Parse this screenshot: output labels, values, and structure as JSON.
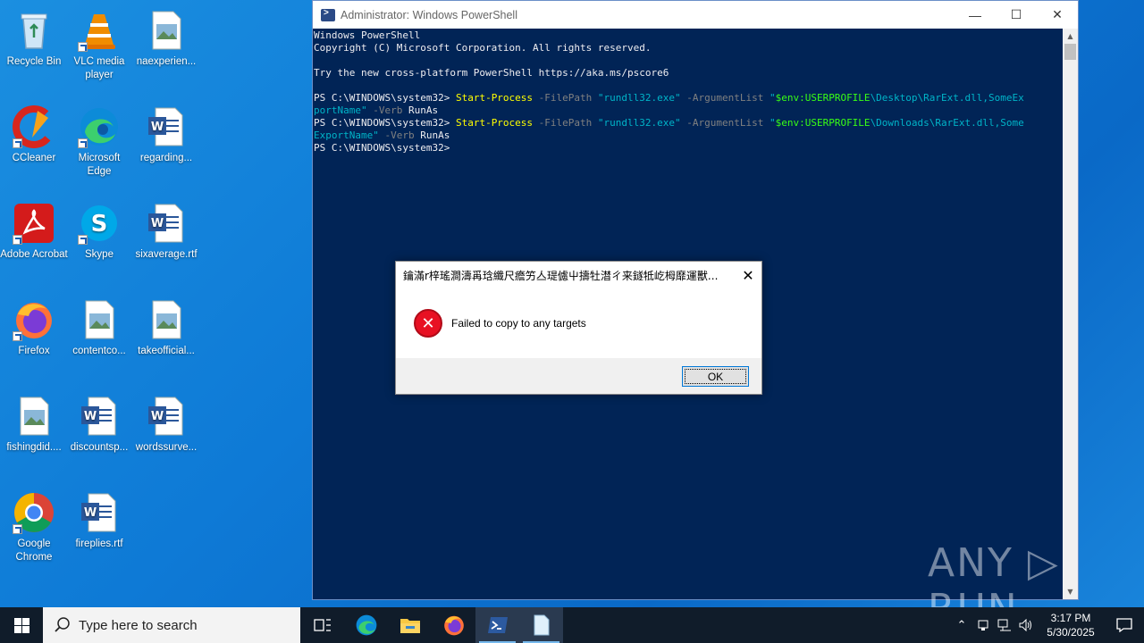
{
  "desktop": {
    "icons": [
      {
        "label": "Recycle Bin",
        "icon": "recycle-bin-icon"
      },
      {
        "label": "VLC media player",
        "icon": "vlc-icon"
      },
      {
        "label": "naexperien...",
        "icon": "image-file-icon"
      },
      {
        "label": "CCleaner",
        "icon": "ccleaner-icon"
      },
      {
        "label": "Microsoft Edge",
        "icon": "edge-icon"
      },
      {
        "label": "regarding...",
        "icon": "word-doc-icon"
      },
      {
        "label": "Adobe Acrobat",
        "icon": "acrobat-icon"
      },
      {
        "label": "Skype",
        "icon": "skype-icon"
      },
      {
        "label": "sixaverage.rtf",
        "icon": "word-doc-icon"
      },
      {
        "label": "Firefox",
        "icon": "firefox-icon"
      },
      {
        "label": "contentco...",
        "icon": "image-file-icon"
      },
      {
        "label": "takeofficial...",
        "icon": "image-file-icon"
      },
      {
        "label": "fishingdid....",
        "icon": "image-file-icon"
      },
      {
        "label": "discountsp...",
        "icon": "word-doc-icon"
      },
      {
        "label": "wordssurve...",
        "icon": "word-doc-icon"
      },
      {
        "label": "Google Chrome",
        "icon": "chrome-icon"
      },
      {
        "label": "fireplies.rtf",
        "icon": "word-doc-icon"
      }
    ]
  },
  "powershell": {
    "title": "Administrator: Windows PowerShell",
    "lines": {
      "l1": "Windows PowerShell",
      "l2": "Copyright (C) Microsoft Corporation. All rights reserved.",
      "l3": "Try the new cross-platform PowerShell https://aka.ms/pscore6",
      "prompt": "PS C:\\WINDOWS\\system32> ",
      "cmd": "Start-Process",
      "p_filepath": " -FilePath ",
      "s_rundll": "\"rundll32.exe\"",
      "p_args": " -ArgumentList ",
      "s_quote": "\"",
      "v_userprofile": "$env:USERPROFILE",
      "s_path1a": "\\Desktop\\RarExt.dll,SomeEx",
      "s_path1b": "portName\"",
      "s_path2a": "\\Downloads\\RarExt.dll,Some",
      "s_path2b": "ExportName\"",
      "p_verb": " -Verb ",
      "runas": "RunAs"
    }
  },
  "dialog": {
    "title": "鑰滿r梓瑤澗濤爯琀纖尺癚竻亼瑅儢屮擣牡澘ㄔ来鐩牴屹栂靡運獸...",
    "message": "Failed to copy to any targets",
    "ok_label": "OK"
  },
  "watermark": "ANY ▷ RUN",
  "taskbar": {
    "search_placeholder": "Type here to search",
    "time": "3:17 PM",
    "date": "5/30/2025"
  },
  "colors": {
    "desktop": "#0e7ad6",
    "console_bg": "#012456",
    "cmdlet": "#ffff00",
    "string": "#00b4c8",
    "variable": "#39ff14",
    "error": "#e81123"
  }
}
